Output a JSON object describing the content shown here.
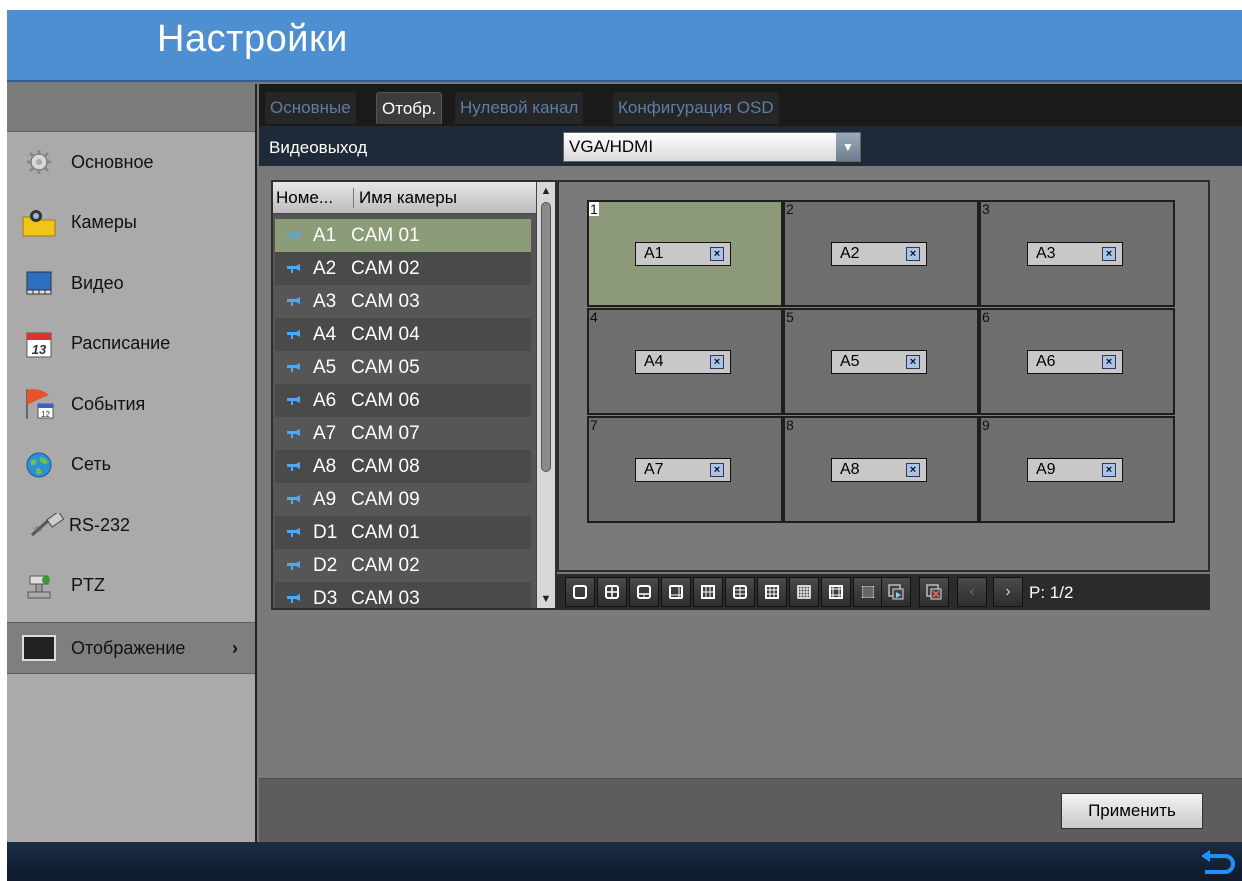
{
  "window": {
    "title": "Настройки"
  },
  "sidebar": {
    "items": [
      {
        "label": "Основное",
        "icon": "gear-icon"
      },
      {
        "label": "Камеры",
        "icon": "camera-folder-icon"
      },
      {
        "label": "Видео",
        "icon": "video-icon"
      },
      {
        "label": "Расписание",
        "icon": "calendar-icon"
      },
      {
        "label": "События",
        "icon": "event-flag-icon"
      },
      {
        "label": "Сеть",
        "icon": "globe-icon"
      },
      {
        "label": "RS-232",
        "icon": "serial-cable-icon"
      },
      {
        "label": "PTZ",
        "icon": "ptz-icon"
      },
      {
        "label": "Отображение",
        "icon": "monitor-icon",
        "active": true,
        "chevron": "›"
      }
    ]
  },
  "tabs": [
    {
      "label": "Основные",
      "active": false
    },
    {
      "label": "Отобр.",
      "active": true
    },
    {
      "label": "Нулевой канал",
      "active": false
    },
    {
      "label": "Конфигурация OSD",
      "active": false
    }
  ],
  "video_output": {
    "label": "Видеовыход",
    "value": "VGA/HDMI"
  },
  "camera_list": {
    "headers": [
      "Номе...",
      "Имя камеры"
    ],
    "rows": [
      {
        "id": "A1",
        "name": "CAM 01",
        "selected": true
      },
      {
        "id": "A2",
        "name": "CAM 02"
      },
      {
        "id": "A3",
        "name": "CAM 03"
      },
      {
        "id": "A4",
        "name": "CAM 04"
      },
      {
        "id": "A5",
        "name": "CAM 05"
      },
      {
        "id": "A6",
        "name": "CAM 06"
      },
      {
        "id": "A7",
        "name": "CAM 07"
      },
      {
        "id": "A8",
        "name": "CAM 08"
      },
      {
        "id": "A9",
        "name": "CAM 09"
      },
      {
        "id": "D1",
        "name": "CAM 01"
      },
      {
        "id": "D2",
        "name": "CAM 02"
      },
      {
        "id": "D3",
        "name": "CAM 03"
      }
    ]
  },
  "layout_grid": {
    "cells": [
      {
        "num": "1",
        "cam": "A1",
        "selected": true
      },
      {
        "num": "2",
        "cam": "A2"
      },
      {
        "num": "3",
        "cam": "A3"
      },
      {
        "num": "4",
        "cam": "A4"
      },
      {
        "num": "5",
        "cam": "A5"
      },
      {
        "num": "6",
        "cam": "A6"
      },
      {
        "num": "7",
        "cam": "A7"
      },
      {
        "num": "8",
        "cam": "A8"
      },
      {
        "num": "9",
        "cam": "A9"
      }
    ],
    "remove_glyph": "×"
  },
  "layout_toolbar": {
    "prev": "‹",
    "next": "›",
    "page": "P: 1/2"
  },
  "apply_label": "Применить",
  "colors": {
    "title_bar": "#4d8fd1",
    "selected_row": "#8c9c78",
    "sidebar": "#aaaaaa",
    "tab_inactive_text": "#5b7ea8"
  }
}
